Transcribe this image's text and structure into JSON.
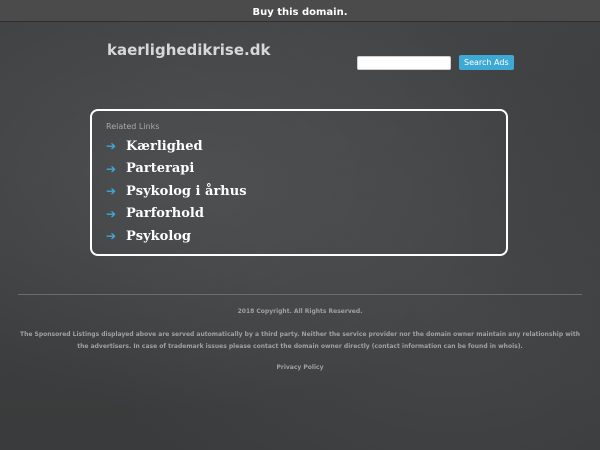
{
  "topbar": {
    "buy_label": "Buy this domain."
  },
  "header": {
    "domain": "kaerlighedikrise.dk"
  },
  "search": {
    "placeholder": "",
    "value": "",
    "button_label": "Search Ads"
  },
  "related": {
    "heading": "Related Links",
    "items": [
      {
        "label": "Kærlighed"
      },
      {
        "label": "Parterapi"
      },
      {
        "label": "Psykolog i århus"
      },
      {
        "label": "Parforhold"
      },
      {
        "label": "Psykolog"
      }
    ]
  },
  "footer": {
    "copyright": "2018 Copyright. All Rights Reserved.",
    "disclaimer": "The Sponsored Listings displayed above are served automatically by a third party. Neither the service provider nor the domain owner maintain any relationship with the advertisers. In case of trademark issues please contact the domain owner directly (contact information can be found in whois).",
    "privacy": "Privacy Policy"
  },
  "colors": {
    "accent": "#3fa9d6",
    "background": "#3d3f40",
    "topbar": "#4b4b4b"
  },
  "icons": {
    "link_arrow": "arrow-right-icon"
  }
}
